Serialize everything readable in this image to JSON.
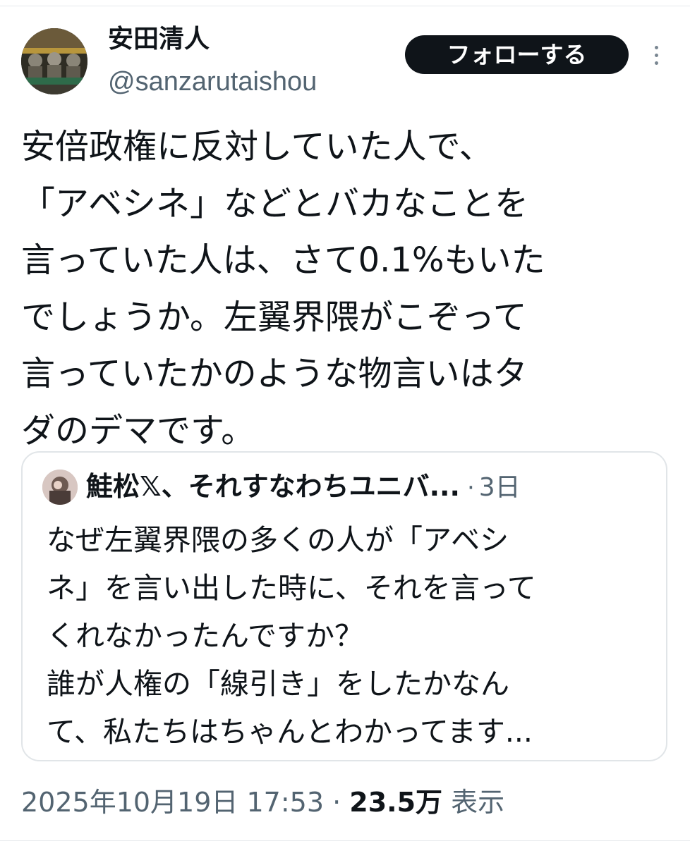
{
  "author": {
    "display_name": "安田清人",
    "handle": "@sanzarutaishou"
  },
  "follow_button_label": "フォローする",
  "more_icon": "more-vertical-icon",
  "tweet_lines": [
    "安倍政権に反対していた人で、",
    "「アベシネ」などとバカなことを",
    "言っていた人は、さて0.1%もいた",
    "でしょうか。左翼界隈がこぞって",
    "言っていたかのような物言いはタ",
    "ダのデマです。"
  ],
  "quote": {
    "author_name": "鮭松𝕏、それすなわちユニバ...",
    "separator": "·",
    "time": "3日",
    "lines": [
      "なぜ左翼界隈の多くの人が「アベシ",
      "ネ」を言い出した時に、それを言って",
      "くれなかったんですか？",
      "誰が人権の「線引き」をしたかなん",
      "て、私たちはちゃんとわかってます..."
    ]
  },
  "meta": {
    "timestamp": "2025年10月19日 17:53",
    "separator": " · ",
    "views_count": "23.5万",
    "views_label": " 表示"
  },
  "colors": {
    "text": "#0f1419",
    "secondary": "#536471",
    "border": "#e1e5e8",
    "button_bg": "#0f1419"
  }
}
